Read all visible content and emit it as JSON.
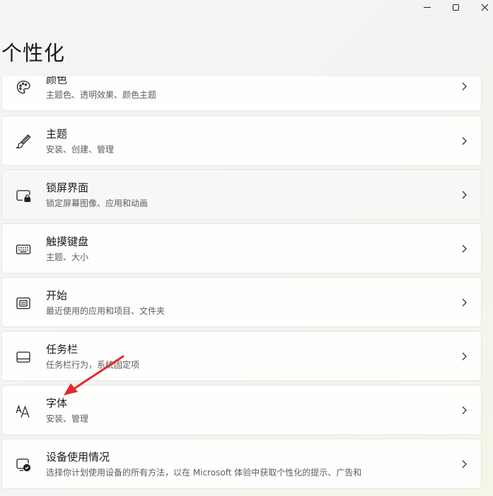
{
  "page": {
    "title": "个性化"
  },
  "items": [
    {
      "title": "颜色",
      "subtitle": "主题色、透明效果、颜色主题",
      "icon": "palette-icon"
    },
    {
      "title": "主题",
      "subtitle": "安装、创建、管理",
      "icon": "brush-icon"
    },
    {
      "title": "锁屏界面",
      "subtitle": "锁定屏幕图像、应用和动画",
      "icon": "lock-screen-icon"
    },
    {
      "title": "触摸键盘",
      "subtitle": "主题、大小",
      "icon": "keyboard-icon"
    },
    {
      "title": "开始",
      "subtitle": "最近使用的应用和项目、文件夹",
      "icon": "start-icon"
    },
    {
      "title": "任务栏",
      "subtitle": "任务栏行为，系统固定项",
      "icon": "taskbar-icon"
    },
    {
      "title": "字体",
      "subtitle": "安装、管理",
      "icon": "font-icon"
    },
    {
      "title": "设备使用情况",
      "subtitle": "选择你计划使用设备的所有方法，以在 Microsoft 体验中获取个性化的提示、广告和",
      "icon": "device-usage-icon"
    }
  ],
  "colors": {
    "annotation_arrow": "#e02b2b",
    "accent": "#1b1b1b"
  }
}
